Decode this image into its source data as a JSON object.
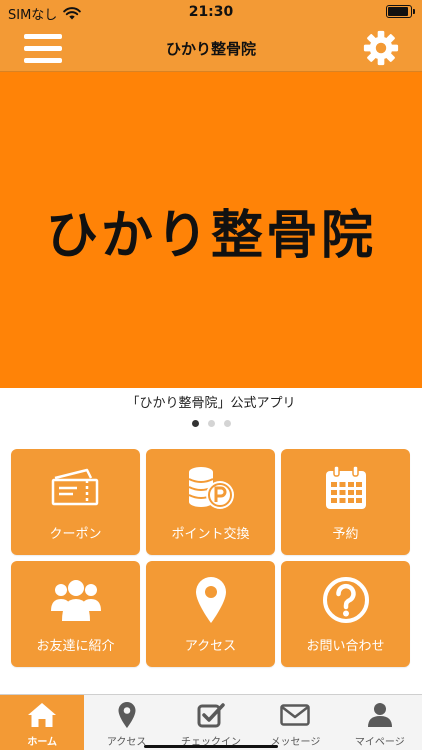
{
  "status": {
    "carrier": "SIMなし",
    "time": "21:30"
  },
  "header": {
    "title": "ひかり整骨院"
  },
  "banner": {
    "text": "ひかり整骨院",
    "caption": "「ひかり整骨院」公式アプリ",
    "slide_count": 3,
    "active_slide": 1
  },
  "menu": {
    "tiles": [
      {
        "label": "クーポン",
        "icon": "ticket-icon"
      },
      {
        "label": "ポイント交換",
        "icon": "coins-point-icon"
      },
      {
        "label": "予約",
        "icon": "calendar-icon"
      },
      {
        "label": "お友達に紹介",
        "icon": "group-icon"
      },
      {
        "label": "アクセス",
        "icon": "map-pin-icon"
      },
      {
        "label": "お問い合わせ",
        "icon": "question-icon"
      }
    ]
  },
  "tabbar": {
    "items": [
      {
        "label": "ホーム",
        "icon": "home-icon",
        "active": true
      },
      {
        "label": "アクセス",
        "icon": "map-pin-icon",
        "active": false
      },
      {
        "label": "チェックイン",
        "icon": "checkbox-icon",
        "active": false
      },
      {
        "label": "メッセージ",
        "icon": "envelope-icon",
        "active": false
      },
      {
        "label": "マイページ",
        "icon": "user-icon",
        "active": false
      }
    ]
  },
  "colors": {
    "header": "#f39a35",
    "banner": "#ff8307",
    "tile": "#f39a35",
    "tab_active": "#f39a35"
  }
}
